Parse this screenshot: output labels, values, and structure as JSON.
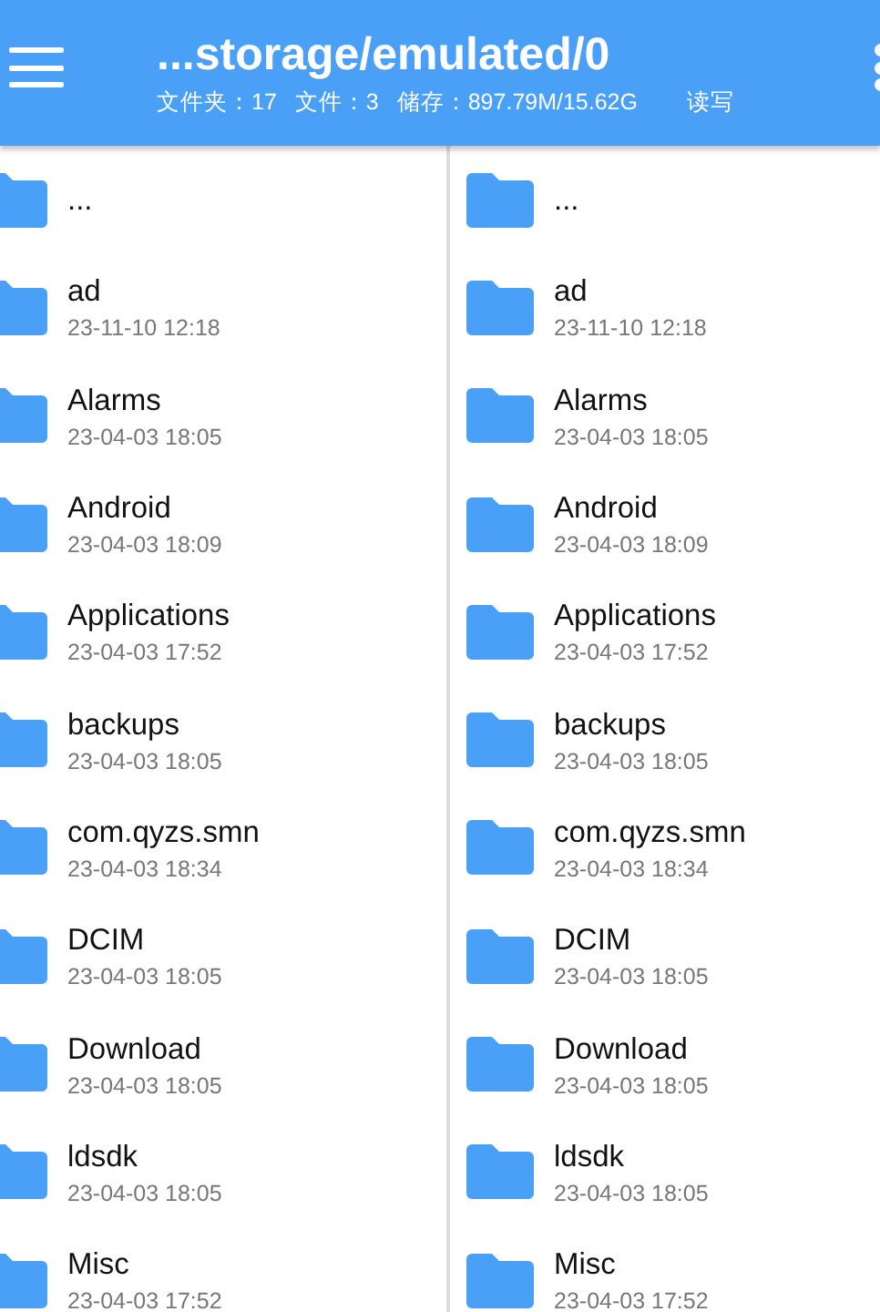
{
  "header": {
    "title": "...storage/emulated/0",
    "stats": [
      "文件夹：17",
      "文件：3",
      "储存：897.79M/15.62G"
    ],
    "mode": "读写"
  },
  "panes": [
    {
      "items": [
        {
          "name": "..."
        },
        {
          "name": "ad",
          "date": "23-11-10 12:18"
        },
        {
          "name": "Alarms",
          "date": "23-04-03 18:05"
        },
        {
          "name": "Android",
          "date": "23-04-03 18:09"
        },
        {
          "name": "Applications",
          "date": "23-04-03 17:52"
        },
        {
          "name": "backups",
          "date": "23-04-03 18:05"
        },
        {
          "name": "com.qyzs.smn",
          "date": "23-04-03 18:34"
        },
        {
          "name": "DCIM",
          "date": "23-04-03 18:05"
        },
        {
          "name": "Download",
          "date": "23-04-03 18:05"
        },
        {
          "name": "ldsdk",
          "date": "23-04-03 18:05"
        },
        {
          "name": "Misc",
          "date": "23-04-03 17:52"
        }
      ]
    },
    {
      "items": [
        {
          "name": "..."
        },
        {
          "name": "ad",
          "date": "23-11-10 12:18"
        },
        {
          "name": "Alarms",
          "date": "23-04-03 18:05"
        },
        {
          "name": "Android",
          "date": "23-04-03 18:09"
        },
        {
          "name": "Applications",
          "date": "23-04-03 17:52"
        },
        {
          "name": "backups",
          "date": "23-04-03 18:05"
        },
        {
          "name": "com.qyzs.smn",
          "date": "23-04-03 18:34"
        },
        {
          "name": "DCIM",
          "date": "23-04-03 18:05"
        },
        {
          "name": "Download",
          "date": "23-04-03 18:05"
        },
        {
          "name": "ldsdk",
          "date": "23-04-03 18:05"
        },
        {
          "name": "Misc",
          "date": "23-04-03 17:52"
        }
      ]
    }
  ]
}
